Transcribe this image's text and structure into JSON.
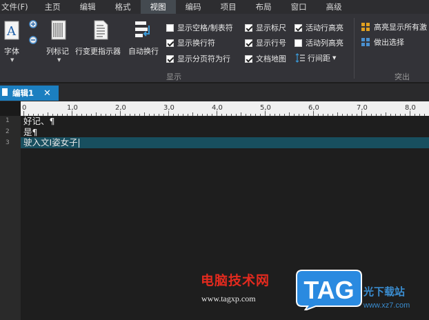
{
  "menubar": {
    "items": [
      "文件(F)",
      "主页",
      "编辑",
      "格式",
      "视图",
      "编码",
      "项目",
      "布局",
      "窗口",
      "高级"
    ],
    "active": "视图"
  },
  "ribbon": {
    "font_label": "字体",
    "column_marker_label": "列标记",
    "change_indicator_label": "行变更指示器",
    "word_wrap_label": "自动换行",
    "checkboxes": [
      {
        "label": "显示空格/制表符",
        "checked": false
      },
      {
        "label": "显示换行符",
        "checked": true
      },
      {
        "label": "显示分页符为行",
        "checked": true
      },
      {
        "label": "显示标尺",
        "checked": true
      },
      {
        "label": "显示行号",
        "checked": true
      },
      {
        "label": "文档地图",
        "checked": true
      },
      {
        "label": "活动行高亮",
        "checked": true
      },
      {
        "label": "活动列高亮",
        "checked": false
      }
    ],
    "line_spacing_label": "行间距",
    "display_group_label": "显示",
    "highlight_all_label": "高亮显示所有激",
    "make_selection_label": "做出选择",
    "highlight_group_label": "突出"
  },
  "tabs": [
    {
      "label": "编辑1"
    }
  ],
  "ruler": {
    "labels": [
      "0",
      "1,0",
      "2,0",
      "3,0",
      "4,0",
      "5,0",
      "6,0",
      "7,0",
      "8,0"
    ]
  },
  "editor": {
    "lines": [
      {
        "number": "1",
        "text": "好记、¶"
      },
      {
        "number": "2",
        "text": "是¶"
      },
      {
        "number": "3",
        "text": "驶入文I姿女子"
      }
    ]
  },
  "watermark": {
    "site_name": "电脑技术网",
    "url": "www.tagxp.com",
    "tag_logo": "TAG",
    "right_text": "光下载站",
    "right_url": "www.xz7.com"
  },
  "colors": {
    "tab_accent": "#1c7fc0",
    "current_line": "#184f5f",
    "watermark_red": "#e32a1e"
  }
}
